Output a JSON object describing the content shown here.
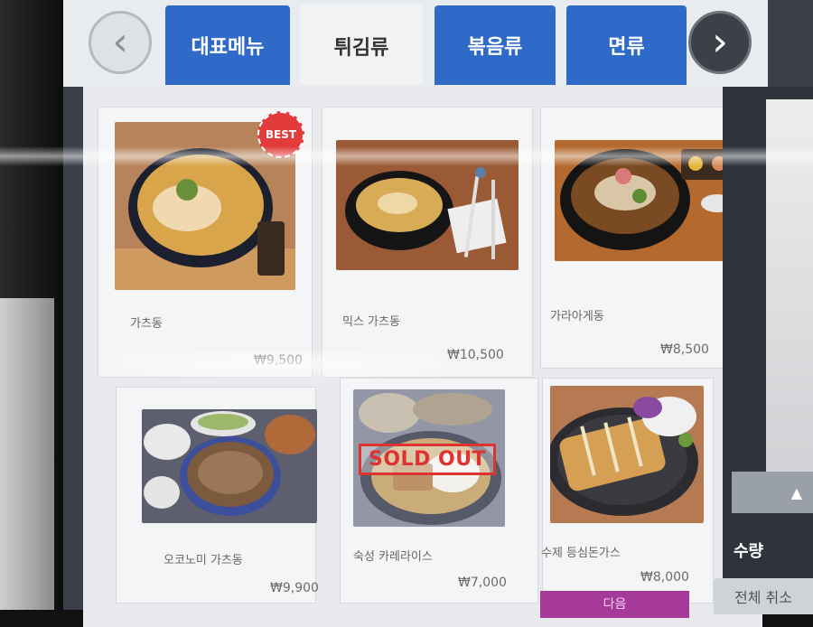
{
  "tabs": [
    {
      "label": "대표메뉴",
      "active": false
    },
    {
      "label": "튀김류",
      "active": true
    },
    {
      "label": "볶음류",
      "active": false
    },
    {
      "label": "면류",
      "active": false
    }
  ],
  "nav": {
    "prev": "‹",
    "next": "›"
  },
  "menu": [
    {
      "name": "가츠동",
      "price": "₩9,500",
      "badge": "BEST",
      "sold_out": false
    },
    {
      "name": "믹스 가츠동",
      "price": "₩10,500",
      "badge": "",
      "sold_out": false
    },
    {
      "name": "가라아게동",
      "price": "₩8,500",
      "badge": "",
      "sold_out": false
    },
    {
      "name": "오코노미 가츠동",
      "price": "₩9,900",
      "badge": "",
      "sold_out": false
    },
    {
      "name": "숙성 카레라이스",
      "price": "₩7,000",
      "badge": "",
      "sold_out": true,
      "sold_out_label": "SOLD OUT"
    },
    {
      "name": "수제 등심돈가스",
      "price": "₩8,000",
      "badge": "",
      "sold_out": false
    }
  ],
  "side": {
    "scroll_up_icon": "▲",
    "quantity_label": "수량",
    "clear_all_label": "전체 취소"
  },
  "bottom": {
    "next_label": "다음"
  },
  "colors": {
    "tab_blue": "#2f6ac8",
    "sold_out_red": "#d33333",
    "best_red": "#e23b3b",
    "next_purple": "#a53a9a"
  }
}
